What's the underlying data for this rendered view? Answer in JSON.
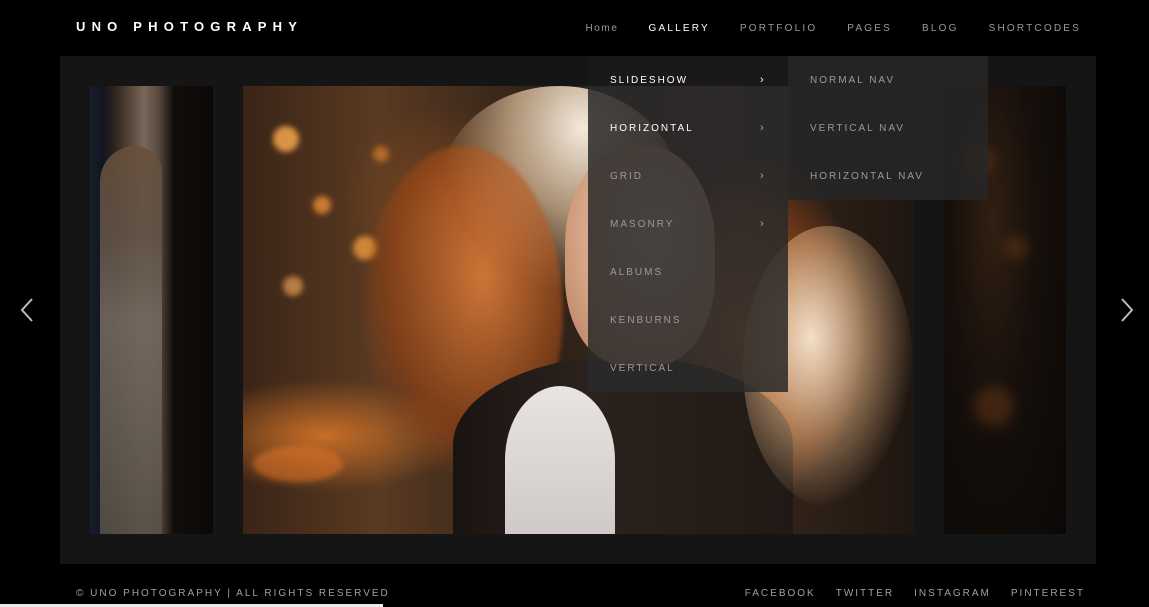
{
  "header": {
    "logo": "UNO PHOTOGRAPHY",
    "nav": [
      {
        "label": "Home"
      },
      {
        "label": "GALLERY"
      },
      {
        "label": "PORTFOLIO"
      },
      {
        "label": "PAGES"
      },
      {
        "label": "BLOG"
      },
      {
        "label": "SHORTCODES"
      }
    ]
  },
  "gallery_menu": {
    "items": [
      {
        "label": "SLIDESHOW",
        "chevron": "›"
      },
      {
        "label": "HORIZONTAL",
        "chevron": "›"
      },
      {
        "label": "GRID",
        "chevron": "›"
      },
      {
        "label": "MASONRY",
        "chevron": "›"
      },
      {
        "label": "ALBUMS"
      },
      {
        "label": "KENBURNS"
      },
      {
        "label": "VERTICAL"
      }
    ],
    "submenu": [
      {
        "label": "NORMAL NAV"
      },
      {
        "label": "VERTICAL NAV"
      },
      {
        "label": "HORIZONTAL NAV"
      }
    ]
  },
  "slider": {
    "prev_icon": "chevron-left-icon",
    "next_icon": "chevron-right-icon"
  },
  "footer": {
    "copyright": "© UNO PHOTOGRAPHY | ALL RIGHTS RESERVED",
    "social": [
      {
        "label": "FACEBOOK"
      },
      {
        "label": "TWITTER"
      },
      {
        "label": "INSTAGRAM"
      },
      {
        "label": "PINTEREST"
      }
    ]
  },
  "colors": {
    "background": "#000000",
    "stage": "#151515",
    "menu_bg": "#2a2a2a",
    "text_active": "#ffffff",
    "text_muted": "#9a9a9a"
  }
}
